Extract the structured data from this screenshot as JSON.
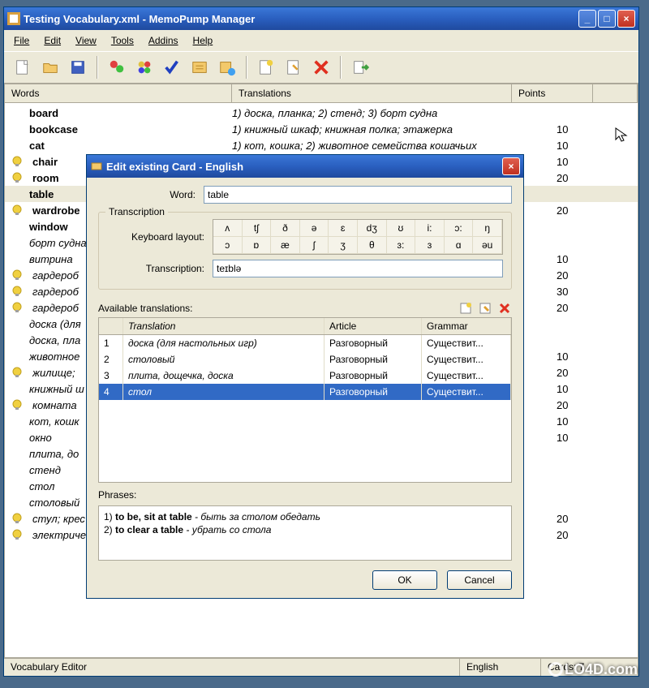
{
  "main": {
    "title": "Testing Vocabulary.xml - MemoPump Manager",
    "menu": [
      "File",
      "Edit",
      "View",
      "Tools",
      "Addins",
      "Help"
    ],
    "columns": {
      "words": "Words",
      "translations": "Translations",
      "points": "Points"
    },
    "rows": [
      {
        "bulb": 0,
        "bold": 1,
        "word": "board",
        "trans": "1) доска, планка; 2) стенд; 3) борт судна",
        "points": ""
      },
      {
        "bulb": 0,
        "bold": 1,
        "word": "bookcase",
        "trans": "1) книжный шкаф; книжная полка; этажерка",
        "points": "10"
      },
      {
        "bulb": 0,
        "bold": 1,
        "word": "cat",
        "trans": "1) кот, кошка; 2) животное семейства кошачьих",
        "points": "10"
      },
      {
        "bulb": 1,
        "bold": 1,
        "word": "chair",
        "trans": "",
        "points": "10"
      },
      {
        "bulb": 1,
        "bold": 1,
        "word": "room",
        "trans": "",
        "points": "20"
      },
      {
        "bulb": 0,
        "bold": 1,
        "word": "table",
        "trans": "",
        "points": "",
        "hl": 1
      },
      {
        "bulb": 1,
        "bold": 1,
        "word": "wardrobe",
        "trans": "",
        "points": "20"
      },
      {
        "bulb": 0,
        "bold": 1,
        "word": "window",
        "trans": "",
        "points": ""
      },
      {
        "bulb": 0,
        "bold": 0,
        "word": "борт судна",
        "trans": "",
        "points": ""
      },
      {
        "bulb": 0,
        "bold": 0,
        "word": "витрина",
        "trans": "",
        "points": "10"
      },
      {
        "bulb": 1,
        "bold": 0,
        "word": "гардероб",
        "trans": "",
        "points": "20"
      },
      {
        "bulb": 1,
        "bold": 0,
        "word": "гардероб",
        "trans": "",
        "points": "30"
      },
      {
        "bulb": 1,
        "bold": 0,
        "word": "гардероб",
        "trans": "",
        "points": "20"
      },
      {
        "bulb": 0,
        "bold": 0,
        "word": "доска (для",
        "trans": "",
        "points": ""
      },
      {
        "bulb": 0,
        "bold": 0,
        "word": "доска, пла",
        "trans": "",
        "points": ""
      },
      {
        "bulb": 0,
        "bold": 0,
        "word": "животное",
        "trans": "",
        "points": "10"
      },
      {
        "bulb": 1,
        "bold": 0,
        "word": "жилище;",
        "trans": "",
        "points": "20"
      },
      {
        "bulb": 0,
        "bold": 0,
        "word": "книжный ш",
        "trans": "",
        "points": "10"
      },
      {
        "bulb": 1,
        "bold": 0,
        "word": "комната",
        "trans": "",
        "points": "20"
      },
      {
        "bulb": 0,
        "bold": 0,
        "word": "кот, кошк",
        "trans": "",
        "points": "10"
      },
      {
        "bulb": 0,
        "bold": 0,
        "word": "окно",
        "trans": "",
        "points": "10"
      },
      {
        "bulb": 0,
        "bold": 0,
        "word": "плита, до",
        "trans": "",
        "points": ""
      },
      {
        "bulb": 0,
        "bold": 0,
        "word": "стенд",
        "trans": "",
        "points": ""
      },
      {
        "bulb": 0,
        "bold": 0,
        "word": "стол",
        "trans": "",
        "points": ""
      },
      {
        "bulb": 0,
        "bold": 0,
        "word": "столовый",
        "trans": "",
        "points": ""
      },
      {
        "bulb": 1,
        "bold": 0,
        "word": "стул; крес",
        "trans": "",
        "points": "20"
      },
      {
        "bulb": 1,
        "bold": 0,
        "word": "электриче",
        "trans": "",
        "points": "20"
      }
    ],
    "status": {
      "left": "Vocabulary Editor",
      "lang": "English",
      "cards": "Cards: 7"
    }
  },
  "dialog": {
    "title": "Edit existing Card - English",
    "wordLabel": "Word:",
    "wordValue": "table",
    "transcription": {
      "legend": "Transcription",
      "layoutLabel": "Keyboard layout:",
      "chars": [
        "ʌ",
        "tʃ",
        "ð",
        "ə",
        "ɛ",
        "dʒ",
        "ʊ",
        "i:",
        "ɔ:",
        "ŋ",
        "ɔ",
        "ɒ",
        "æ",
        "ʃ",
        "ʒ",
        "θ",
        "ɜ:",
        "ɜ",
        "ɑ",
        "əu"
      ],
      "transcriptionLabel": "Transcription:",
      "transcriptionValue": "teɪblə"
    },
    "available": {
      "label": "Available translations:",
      "cols": {
        "num": "",
        "trans": "Translation",
        "article": "Article",
        "grammar": "Grammar"
      },
      "rows": [
        {
          "n": "1",
          "t": "доска (для настольных игр)",
          "a": "Разговорный",
          "g": "Существит..."
        },
        {
          "n": "2",
          "t": "столовый",
          "a": "Разговорный",
          "g": "Существит..."
        },
        {
          "n": "3",
          "t": "плита, дощечка, доска",
          "a": "Разговорный",
          "g": "Существит..."
        },
        {
          "n": "4",
          "t": "стол",
          "a": "Разговорный",
          "g": "Существит...",
          "sel": 1
        }
      ]
    },
    "phrases": {
      "label": "Phrases:",
      "lines": [
        {
          "pre": "1) ",
          "b": "to be, sit at table",
          "i": " - быть за столом обедать"
        },
        {
          "pre": "2) ",
          "b": "to clear a table",
          "i": " - убрать со стола"
        }
      ]
    },
    "buttons": {
      "ok": "OK",
      "cancel": "Cancel"
    }
  },
  "watermark": "LO4D.com"
}
